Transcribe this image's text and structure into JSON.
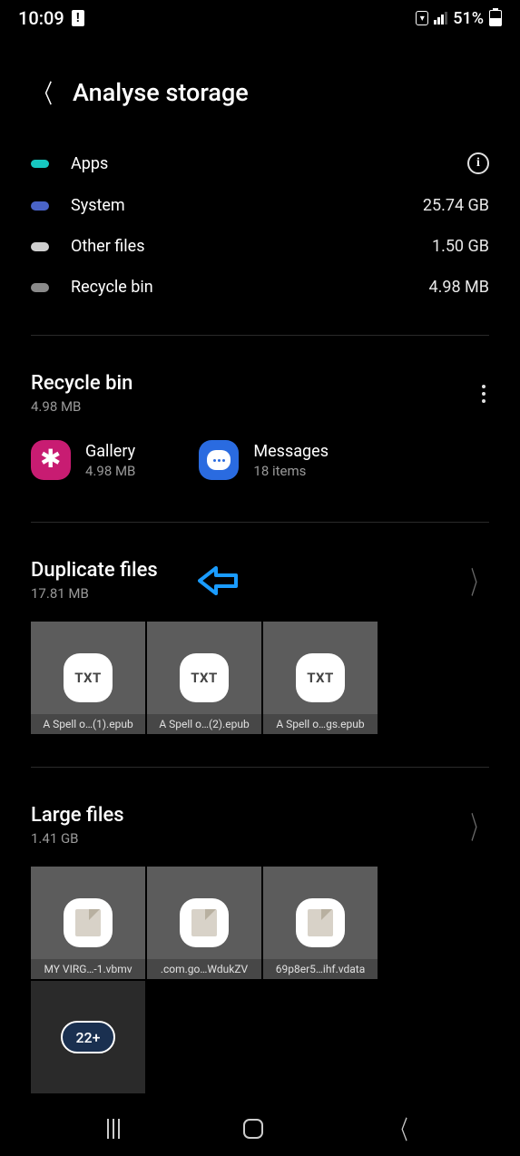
{
  "status": {
    "time": "10:09",
    "battery_pct": "51%"
  },
  "header": {
    "title": "Analyse storage"
  },
  "categories": [
    {
      "label": "Apps",
      "color": "#17c7c0",
      "value": null,
      "info": true
    },
    {
      "label": "System",
      "color": "#4a64c8",
      "value": "25.74 GB",
      "info": false
    },
    {
      "label": "Other files",
      "color": "#d0d0d0",
      "value": "1.50 GB",
      "info": false
    },
    {
      "label": "Recycle bin",
      "color": "#8a8a8a",
      "value": "4.98 MB",
      "info": false
    }
  ],
  "recycle": {
    "title": "Recycle bin",
    "size": "4.98 MB",
    "apps": [
      {
        "name": "Gallery",
        "sub": "4.98 MB",
        "bg": "#c81c72",
        "icon": "flower"
      },
      {
        "name": "Messages",
        "sub": "18 items",
        "bg": "#2a6be0",
        "icon": "bubble"
      }
    ]
  },
  "duplicates": {
    "title": "Duplicate files",
    "size": "17.81 MB",
    "files": [
      {
        "label": "A Spell o…(1).epub"
      },
      {
        "label": "A Spell o…(2).epub"
      },
      {
        "label": "A Spell o…gs.epub"
      }
    ]
  },
  "large": {
    "title": "Large files",
    "size": "1.41 GB",
    "more_count": "22+",
    "files": [
      {
        "label": "MY VIRG…-1.vbmv"
      },
      {
        "label": ".com.go…WdukZV"
      },
      {
        "label": "69p8er5…ihf.vdata"
      }
    ]
  }
}
